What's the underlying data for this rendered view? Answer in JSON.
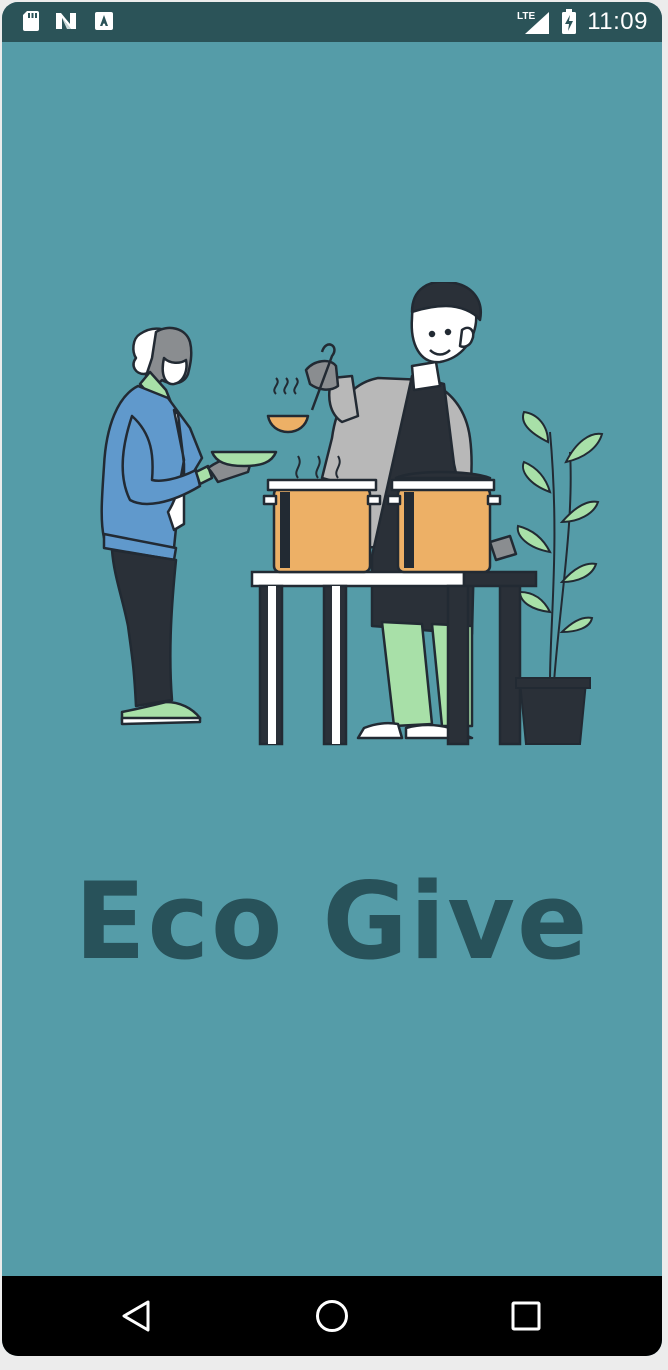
{
  "status_bar": {
    "time": "11:09",
    "network": "LTE",
    "left_icons": [
      "sd-card-icon",
      "n-logo-icon",
      "a-notification-icon"
    ],
    "right_icons": [
      "lte-signal-icon",
      "battery-charging-icon"
    ]
  },
  "app": {
    "title": "Eco Give",
    "illustration": "volunteer-serving-soup-illustration"
  },
  "nav_bar": {
    "buttons": [
      "back-icon",
      "home-icon",
      "recents-icon"
    ]
  },
  "colors": {
    "background": "#559ca8",
    "status_bar": "#2b5358",
    "title": "#28525a",
    "pot": "#edb066",
    "accent_green": "#a8e0a8"
  }
}
